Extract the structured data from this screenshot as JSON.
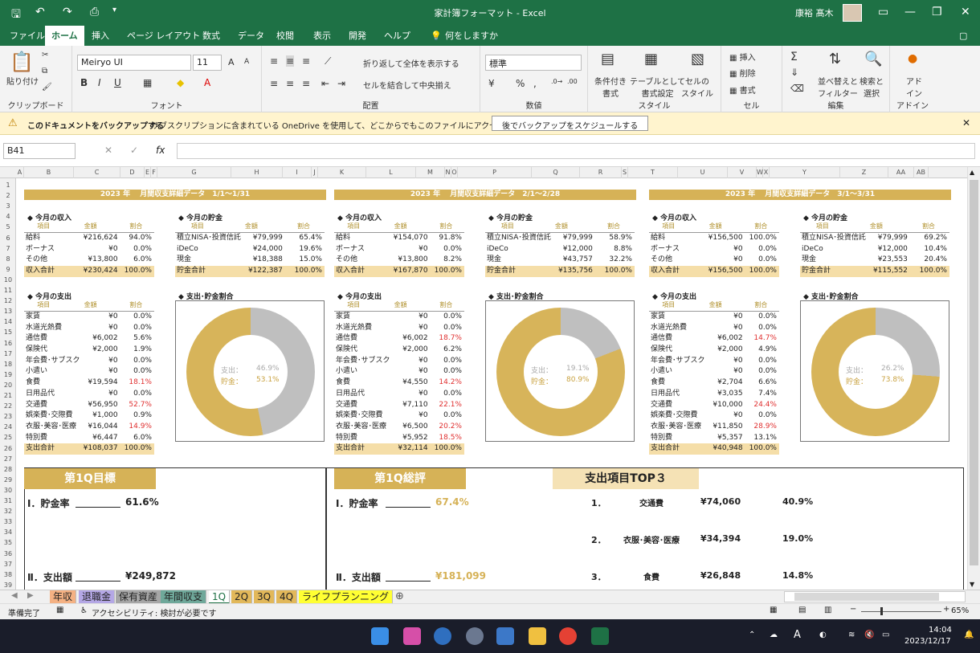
{
  "window": {
    "title": "家計簿フォーマット  -  Excel",
    "user": "康裕 髙木"
  },
  "menus": [
    "ファイル",
    "ホーム",
    "挿入",
    "ページ レイアウト",
    "数式",
    "データ",
    "校閲",
    "表示",
    "開発",
    "ヘルプ",
    "何をしますか"
  ],
  "ribbon": {
    "paste": "貼り付け",
    "clipboard": "クリップボード",
    "font_name": "Meiryo UI",
    "font_size": "11",
    "font": "フォント",
    "wrap": "折り返して全体を表示する",
    "merge": "セルを結合して中央揃え",
    "alignment": "配置",
    "number_format": "標準",
    "number": "数値",
    "cond": "条件付き\n書式",
    "table": "テーブルとして\n書式設定",
    "cellstyle": "セルの\nスタイル",
    "style": "スタイル",
    "insert": "挿入",
    "delete": "削除",
    "format": "書式",
    "cells": "セル",
    "sort": "並べ替えと\nフィルター",
    "find": "検索と\n選択",
    "edit": "編集",
    "addin": "アド\nイン",
    "addin_group": "アドイン"
  },
  "message": {
    "bold": "このドキュメントをバックアップする",
    "text": "サブスクリプションに含まれている OneDrive を使用して、どこからでもこのファイルにアクセスできます。",
    "button": "後でバックアップをスケジュールする"
  },
  "formula": {
    "namebox": "B41",
    "fx": "fx",
    "value": ""
  },
  "columns": [
    "A",
    "B",
    "C",
    "D",
    "E",
    "F",
    "G",
    "H",
    "I",
    "J",
    "K",
    "L",
    "M",
    "N",
    "O",
    "P",
    "Q",
    "R",
    "S",
    "T",
    "U",
    "V",
    "W",
    "X",
    "Y",
    "Z",
    "AA",
    "AB"
  ],
  "rows": [
    "1",
    "2",
    "3",
    "4",
    "5",
    "6",
    "7",
    "8",
    "9",
    "10",
    "11",
    "12",
    "13",
    "14",
    "15",
    "16",
    "17",
    "18",
    "19",
    "20",
    "21",
    "22",
    "23",
    "24",
    "25",
    "26",
    "27",
    "28",
    "29",
    "30",
    "31",
    "32",
    "33",
    "34",
    "35",
    "36",
    "37",
    "38",
    "39"
  ],
  "months": [
    {
      "title": "2023 年　 月間収支詳細データ　1/1～1/31",
      "income": {
        "title": "◆ 今月の収入",
        "headers": [
          "項目",
          "金額",
          "割合"
        ],
        "rows": [
          [
            "給料",
            "¥216,624",
            "94.0%"
          ],
          [
            "ボーナス",
            "¥0",
            "0.0%"
          ],
          [
            "その他",
            "¥13,800",
            "6.0%"
          ]
        ],
        "total": [
          "収入合計",
          "¥230,424",
          "100.0%"
        ]
      },
      "saving": {
        "title": "◆ 今月の貯金",
        "headers": [
          "項目",
          "金額",
          "割合"
        ],
        "rows": [
          [
            "積立NISA･投資信託",
            "¥79,999",
            "65.4%"
          ],
          [
            "iDeCo",
            "¥24,000",
            "19.6%"
          ],
          [
            "現金",
            "¥18,388",
            "15.0%"
          ]
        ],
        "total": [
          "貯金合計",
          "¥122,387",
          "100.0%"
        ]
      },
      "expense": {
        "title": "◆ 今月の支出",
        "headers": [
          "項目",
          "金額",
          "割合"
        ],
        "rows": [
          [
            "家賃",
            "¥0",
            "0.0%"
          ],
          [
            "水道光熱費",
            "¥0",
            "0.0%"
          ],
          [
            "通信費",
            "¥6,002",
            "5.6%"
          ],
          [
            "保険代",
            "¥2,000",
            "1.9%"
          ],
          [
            "年会費･サブスク",
            "¥0",
            "0.0%"
          ],
          [
            "小遣い",
            "¥0",
            "0.0%"
          ],
          [
            "食費",
            "¥19,594",
            "18.1%"
          ],
          [
            "日用品代",
            "¥0",
            "0.0%"
          ],
          [
            "交通費",
            "¥56,950",
            "52.7%"
          ],
          [
            "娯楽費･交際費",
            "¥1,000",
            "0.9%"
          ],
          [
            "衣服･美容･医療",
            "¥16,044",
            "14.9%"
          ],
          [
            "特別費",
            "¥6,447",
            "6.0%"
          ]
        ],
        "total": [
          "支出合計",
          "¥108,037",
          "100.0%"
        ]
      },
      "chart": {
        "title": "◆ 支出･貯金割合",
        "expense_label": "支出：",
        "expense_pct": "46.9%",
        "saving_label": "貯金：",
        "saving_pct": "53.1%",
        "expense_value": 46.9
      }
    },
    {
      "title": "2023 年　 月間収支詳細データ　2/1～2/28",
      "income": {
        "title": "◆ 今月の収入",
        "headers": [
          "項目",
          "金額",
          "割合"
        ],
        "rows": [
          [
            "給料",
            "¥154,070",
            "91.8%"
          ],
          [
            "ボーナス",
            "¥0",
            "0.0%"
          ],
          [
            "その他",
            "¥13,800",
            "8.2%"
          ]
        ],
        "total": [
          "収入合計",
          "¥167,870",
          "100.0%"
        ]
      },
      "saving": {
        "title": "◆ 今月の貯金",
        "headers": [
          "項目",
          "金額",
          "割合"
        ],
        "rows": [
          [
            "積立NISA･投資信託",
            "¥79,999",
            "58.9%"
          ],
          [
            "iDeCo",
            "¥12,000",
            "8.8%"
          ],
          [
            "現金",
            "¥43,757",
            "32.2%"
          ]
        ],
        "total": [
          "貯金合計",
          "¥135,756",
          "100.0%"
        ]
      },
      "expense": {
        "title": "◆ 今月の支出",
        "headers": [
          "項目",
          "金額",
          "割合"
        ],
        "rows": [
          [
            "家賃",
            "¥0",
            "0.0%"
          ],
          [
            "水道光熱費",
            "¥0",
            "0.0%"
          ],
          [
            "通信費",
            "¥6,002",
            "18.7%"
          ],
          [
            "保険代",
            "¥2,000",
            "6.2%"
          ],
          [
            "年会費･サブスク",
            "¥0",
            "0.0%"
          ],
          [
            "小遣い",
            "¥0",
            "0.0%"
          ],
          [
            "食費",
            "¥4,550",
            "14.2%"
          ],
          [
            "日用品代",
            "¥0",
            "0.0%"
          ],
          [
            "交通費",
            "¥7,110",
            "22.1%"
          ],
          [
            "娯楽費･交際費",
            "¥0",
            "0.0%"
          ],
          [
            "衣服･美容･医療",
            "¥6,500",
            "20.2%"
          ],
          [
            "特別費",
            "¥5,952",
            "18.5%"
          ]
        ],
        "total": [
          "支出合計",
          "¥32,114",
          "100.0%"
        ]
      },
      "chart": {
        "title": "◆ 支出･貯金割合",
        "expense_label": "支出：",
        "expense_pct": "19.1%",
        "saving_label": "貯金：",
        "saving_pct": "80.9%",
        "expense_value": 19.1
      }
    },
    {
      "title": "2023 年　 月間収支詳細データ　3/1～3/31",
      "income": {
        "title": "◆ 今月の収入",
        "headers": [
          "項目",
          "金額",
          "割合"
        ],
        "rows": [
          [
            "給料",
            "¥156,500",
            "100.0%"
          ],
          [
            "ボーナス",
            "¥0",
            "0.0%"
          ],
          [
            "その他",
            "¥0",
            "0.0%"
          ]
        ],
        "total": [
          "収入合計",
          "¥156,500",
          "100.0%"
        ]
      },
      "saving": {
        "title": "◆ 今月の貯金",
        "headers": [
          "項目",
          "金額",
          "割合"
        ],
        "rows": [
          [
            "積立NISA･投資信託",
            "¥79,999",
            "69.2%"
          ],
          [
            "iDeCo",
            "¥12,000",
            "10.4%"
          ],
          [
            "現金",
            "¥23,553",
            "20.4%"
          ]
        ],
        "total": [
          "貯金合計",
          "¥115,552",
          "100.0%"
        ]
      },
      "expense": {
        "title": "◆ 今月の支出",
        "headers": [
          "項目",
          "金額",
          "割合"
        ],
        "rows": [
          [
            "家賃",
            "¥0",
            "0.0%"
          ],
          [
            "水道光熱費",
            "¥0",
            "0.0%"
          ],
          [
            "通信費",
            "¥6,002",
            "14.7%"
          ],
          [
            "保険代",
            "¥2,000",
            "4.9%"
          ],
          [
            "年会費･サブスク",
            "¥0",
            "0.0%"
          ],
          [
            "小遣い",
            "¥0",
            "0.0%"
          ],
          [
            "食費",
            "¥2,704",
            "6.6%"
          ],
          [
            "日用品代",
            "¥3,035",
            "7.4%"
          ],
          [
            "交通費",
            "¥10,000",
            "24.4%"
          ],
          [
            "娯楽費･交際費",
            "¥0",
            "0.0%"
          ],
          [
            "衣服･美容･医療",
            "¥11,850",
            "28.9%"
          ],
          [
            "特別費",
            "¥5,357",
            "13.1%"
          ]
        ],
        "total": [
          "支出合計",
          "¥40,948",
          "100.0%"
        ]
      },
      "chart": {
        "title": "◆ 支出･貯金割合",
        "expense_label": "支出：",
        "expense_pct": "26.2%",
        "saving_label": "貯金：",
        "saving_pct": "73.8%",
        "expense_value": 26.2
      }
    }
  ],
  "summary": {
    "goal": {
      "title": "第1Q目標",
      "l1": "Ⅰ．貯金率",
      "v1": "61.6%",
      "l2": "Ⅱ．支出額",
      "v2": "¥249,872"
    },
    "review": {
      "title": "第1Q総評",
      "l1": "Ⅰ．貯金率",
      "v1": "67.4%",
      "l2": "Ⅱ．支出額",
      "v2": "¥181,099"
    },
    "top3": {
      "title": "支出項目TOP３",
      "items": [
        [
          "1．",
          "交通費",
          "¥74,060",
          "40.9%"
        ],
        [
          "2．",
          "衣服･美容･医療",
          "¥34,394",
          "19.0%"
        ],
        [
          "3．",
          "食費",
          "¥26,848",
          "14.8%"
        ]
      ]
    }
  },
  "sheets": [
    {
      "name": "年収",
      "color": "#f4b183"
    },
    {
      "name": "退職金",
      "color": "#b4a7e5"
    },
    {
      "name": "保有資産",
      "color": "#a6a6a6"
    },
    {
      "name": "年間収支",
      "color": "#6fa89a"
    },
    {
      "name": "1Q",
      "color": "#ffffff"
    },
    {
      "name": "2Q",
      "color": "#e2b85a"
    },
    {
      "name": "3Q",
      "color": "#e2b85a"
    },
    {
      "name": "4Q",
      "color": "#e2b85a"
    },
    {
      "name": "ライフプランニング",
      "color": "#ffff33"
    }
  ],
  "status": {
    "ready": "準備完了",
    "access": "アクセシビリティ: 検討が必要です",
    "zoom": "65%"
  },
  "taskbar": {
    "time": "14:04",
    "date": "2023/12/17"
  },
  "colors": {
    "gold": "#d6b257",
    "excel_green": "#1e7145",
    "saving_gold": "#d7b45a",
    "expense_grey": "#bfbfbf"
  }
}
